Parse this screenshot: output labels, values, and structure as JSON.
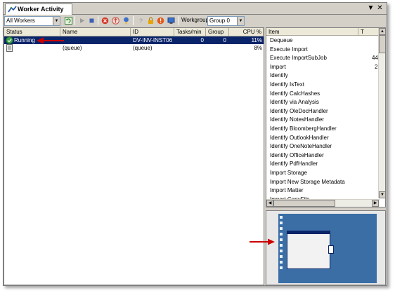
{
  "window": {
    "tab_label": "Worker Activity",
    "menu_glyph": "▼",
    "close_glyph": "✕"
  },
  "toolbar": {
    "worker_filter_value": "All Workers",
    "workgroup_label": "Workgroup",
    "workgroup_value": "Group 0"
  },
  "grid": {
    "columns": [
      "Status",
      "Name",
      "ID",
      "Tasks/min",
      "Group",
      "CPU %"
    ],
    "rows": [
      {
        "status": "Running",
        "name": "",
        "id": "DV-INV-INST06",
        "tasks_per_min": "0",
        "group": "0",
        "cpu": "11%"
      },
      {
        "status": "",
        "name": "(queue)",
        "id": "(queue)",
        "tasks_per_min": "",
        "group": "",
        "cpu": "8%"
      }
    ]
  },
  "task_list": {
    "columns": [
      "Item",
      "T"
    ],
    "items": [
      "Dequeue",
      "Execute Import",
      "Execute ImportSubJob",
      "Import",
      "Identify",
      "Identify IsText",
      "Identify CalcHashes",
      "Identify via Analysis",
      "Identify OleDocHandler",
      "Identify NotesHandler",
      "Identify BloombergHandler",
      "Identify OutlookHandler",
      "Identify OneNoteHandler",
      "Identify OfficeHandler",
      "Identify PdfHandler",
      "Import Storage",
      "Import New Storage Metadata",
      "Import Matter",
      "Import CopyFile"
    ],
    "counts": [
      "44",
      "2"
    ]
  },
  "colors": {
    "selection": "#0a246a",
    "annotation_arrow": "#cc0000",
    "preview_desktop": "#3a6ea5"
  }
}
